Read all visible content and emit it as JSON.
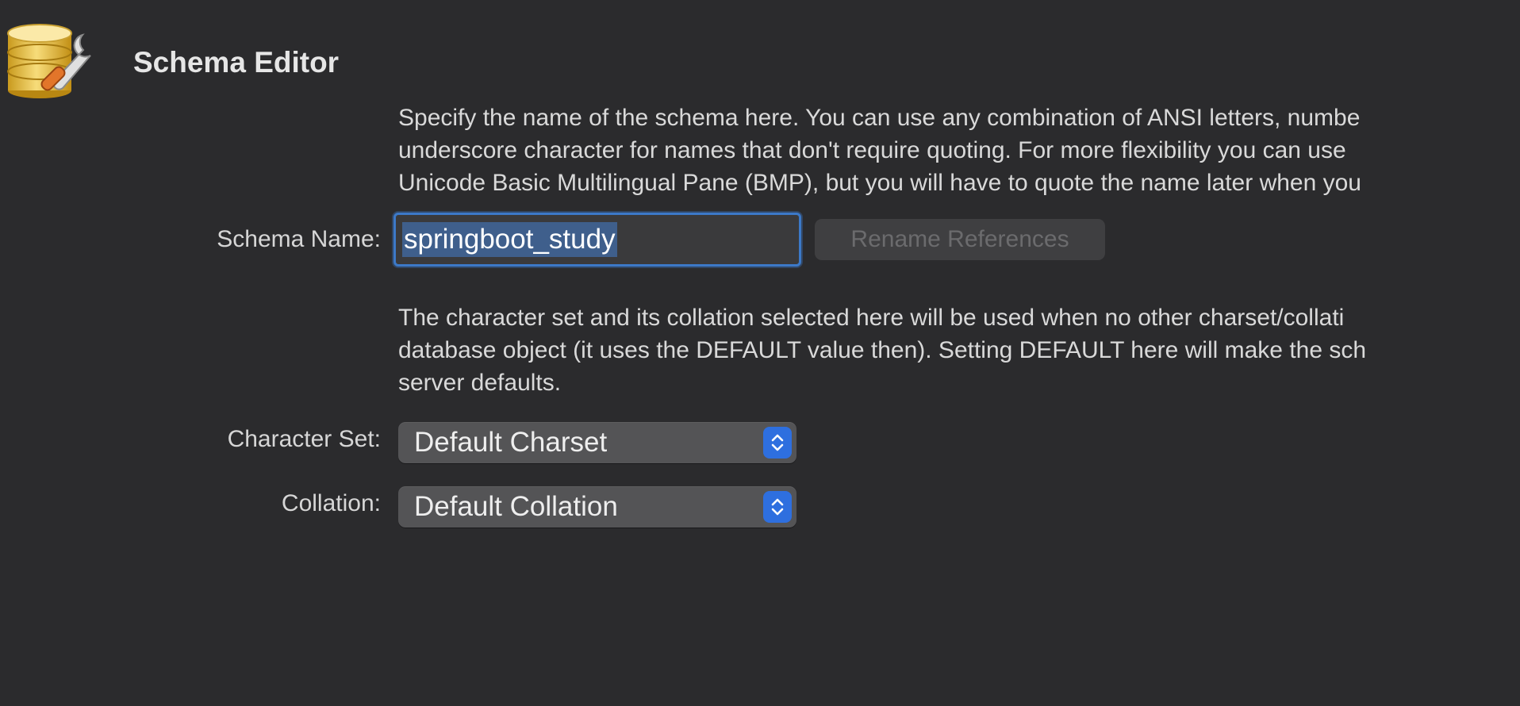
{
  "editor": {
    "title": "Schema Editor",
    "name_description": [
      "Specify the name of the schema here. You can use any combination of ANSI letters, numbe",
      "underscore character for names that don't require quoting. For more flexibility you can use",
      "Unicode Basic Multilingual Pane (BMP), but you will have to quote the name later when you"
    ],
    "schema_name_label": "Schema Name:",
    "schema_name_value": "springboot_study",
    "rename_button_label": "Rename References",
    "charset_description": [
      "The character set and its collation selected here will be used when no other charset/collati",
      "database object (it uses the DEFAULT value then). Setting DEFAULT here will make the sch",
      "server defaults."
    ],
    "character_set_label": "Character Set:",
    "character_set_value": "Default Charset",
    "collation_label": "Collation:",
    "collation_value": "Default Collation"
  },
  "colors": {
    "background": "#2b2b2d",
    "focus_ring": "#3c79c8",
    "stepper": "#2e6fdf",
    "disabled_text": "#6b6b6d"
  },
  "icons": {
    "app": "database-wrench-icon",
    "stepper": "chevron-up-down-icon"
  }
}
